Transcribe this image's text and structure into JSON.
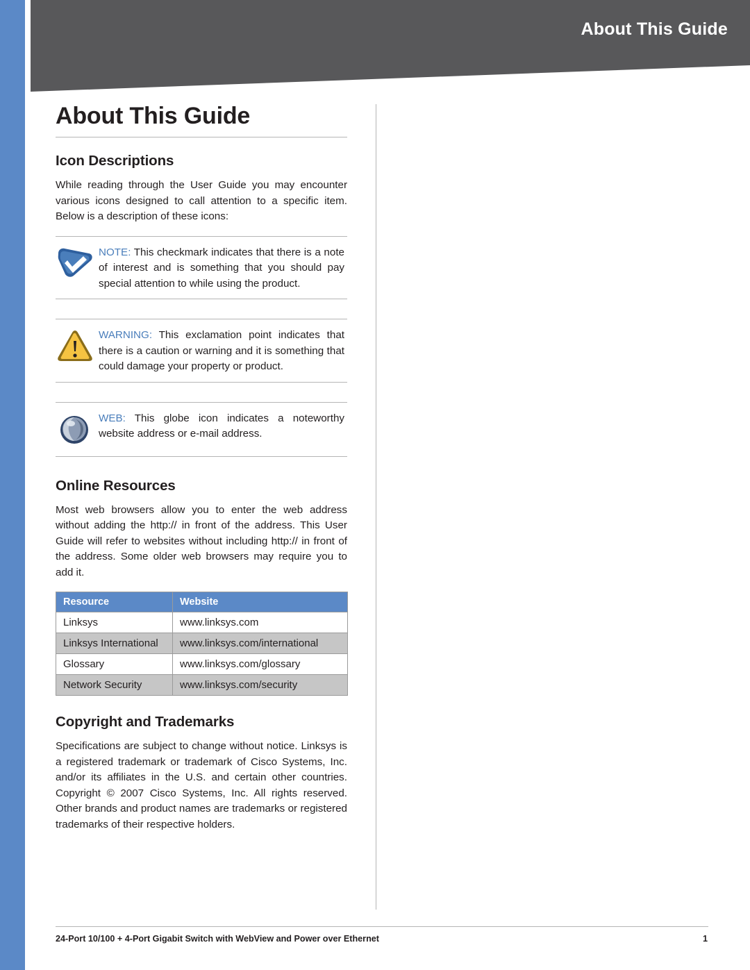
{
  "header": {
    "title": "About This Guide"
  },
  "page": {
    "title": "About This Guide"
  },
  "sections": {
    "icon_descriptions": {
      "heading": "Icon Descriptions",
      "intro": "While reading through the User Guide you may encounter various icons designed to call attention to a specific item. Below is a description of these icons:",
      "notes": [
        {
          "icon": "note-checkmark-icon",
          "label": "NOTE:",
          "text": " This checkmark indicates that there is a note of interest and is something that you should pay special attention to while using the product."
        },
        {
          "icon": "warning-exclamation-icon",
          "label": "WARNING:",
          "text": " This exclamation point indicates that there is a caution or warning and it is something that could damage your property or product."
        },
        {
          "icon": "web-globe-icon",
          "label": "WEB:",
          "text": " This globe icon indicates a noteworthy website address or e-mail address."
        }
      ]
    },
    "online_resources": {
      "heading": "Online Resources",
      "paragraph": "Most web browsers allow you to enter the web address without adding the http:// in front of the address. This User Guide will refer to websites without including http:// in front of the address. Some older web browsers may require you to add it.",
      "table": {
        "columns": [
          "Resource",
          "Website"
        ],
        "rows": [
          [
            "Linksys",
            "www.linksys.com"
          ],
          [
            "Linksys International",
            "www.linksys.com/international"
          ],
          [
            "Glossary",
            "www.linksys.com/glossary"
          ],
          [
            "Network Security",
            "www.linksys.com/security"
          ]
        ]
      }
    },
    "copyright": {
      "heading": "Copyright and Trademarks",
      "paragraph": "Specifications are subject to change without notice. Linksys is a registered trademark or trademark of Cisco Systems, Inc. and/or its affiliates in the U.S. and certain other countries. Copyright © 2007 Cisco Systems, Inc. All rights reserved. Other brands and product names are trademarks or registered trademarks of their respective holders."
    }
  },
  "footer": {
    "text": "24-Port 10/100 + 4-Port Gigabit Switch with WebView and Power over Ethernet",
    "page_number": "1"
  },
  "colors": {
    "accent_blue": "#5b89c7",
    "header_gray": "#58585a",
    "label_blue": "#4a7ebb",
    "table_alt_row": "#c6c6c6"
  }
}
